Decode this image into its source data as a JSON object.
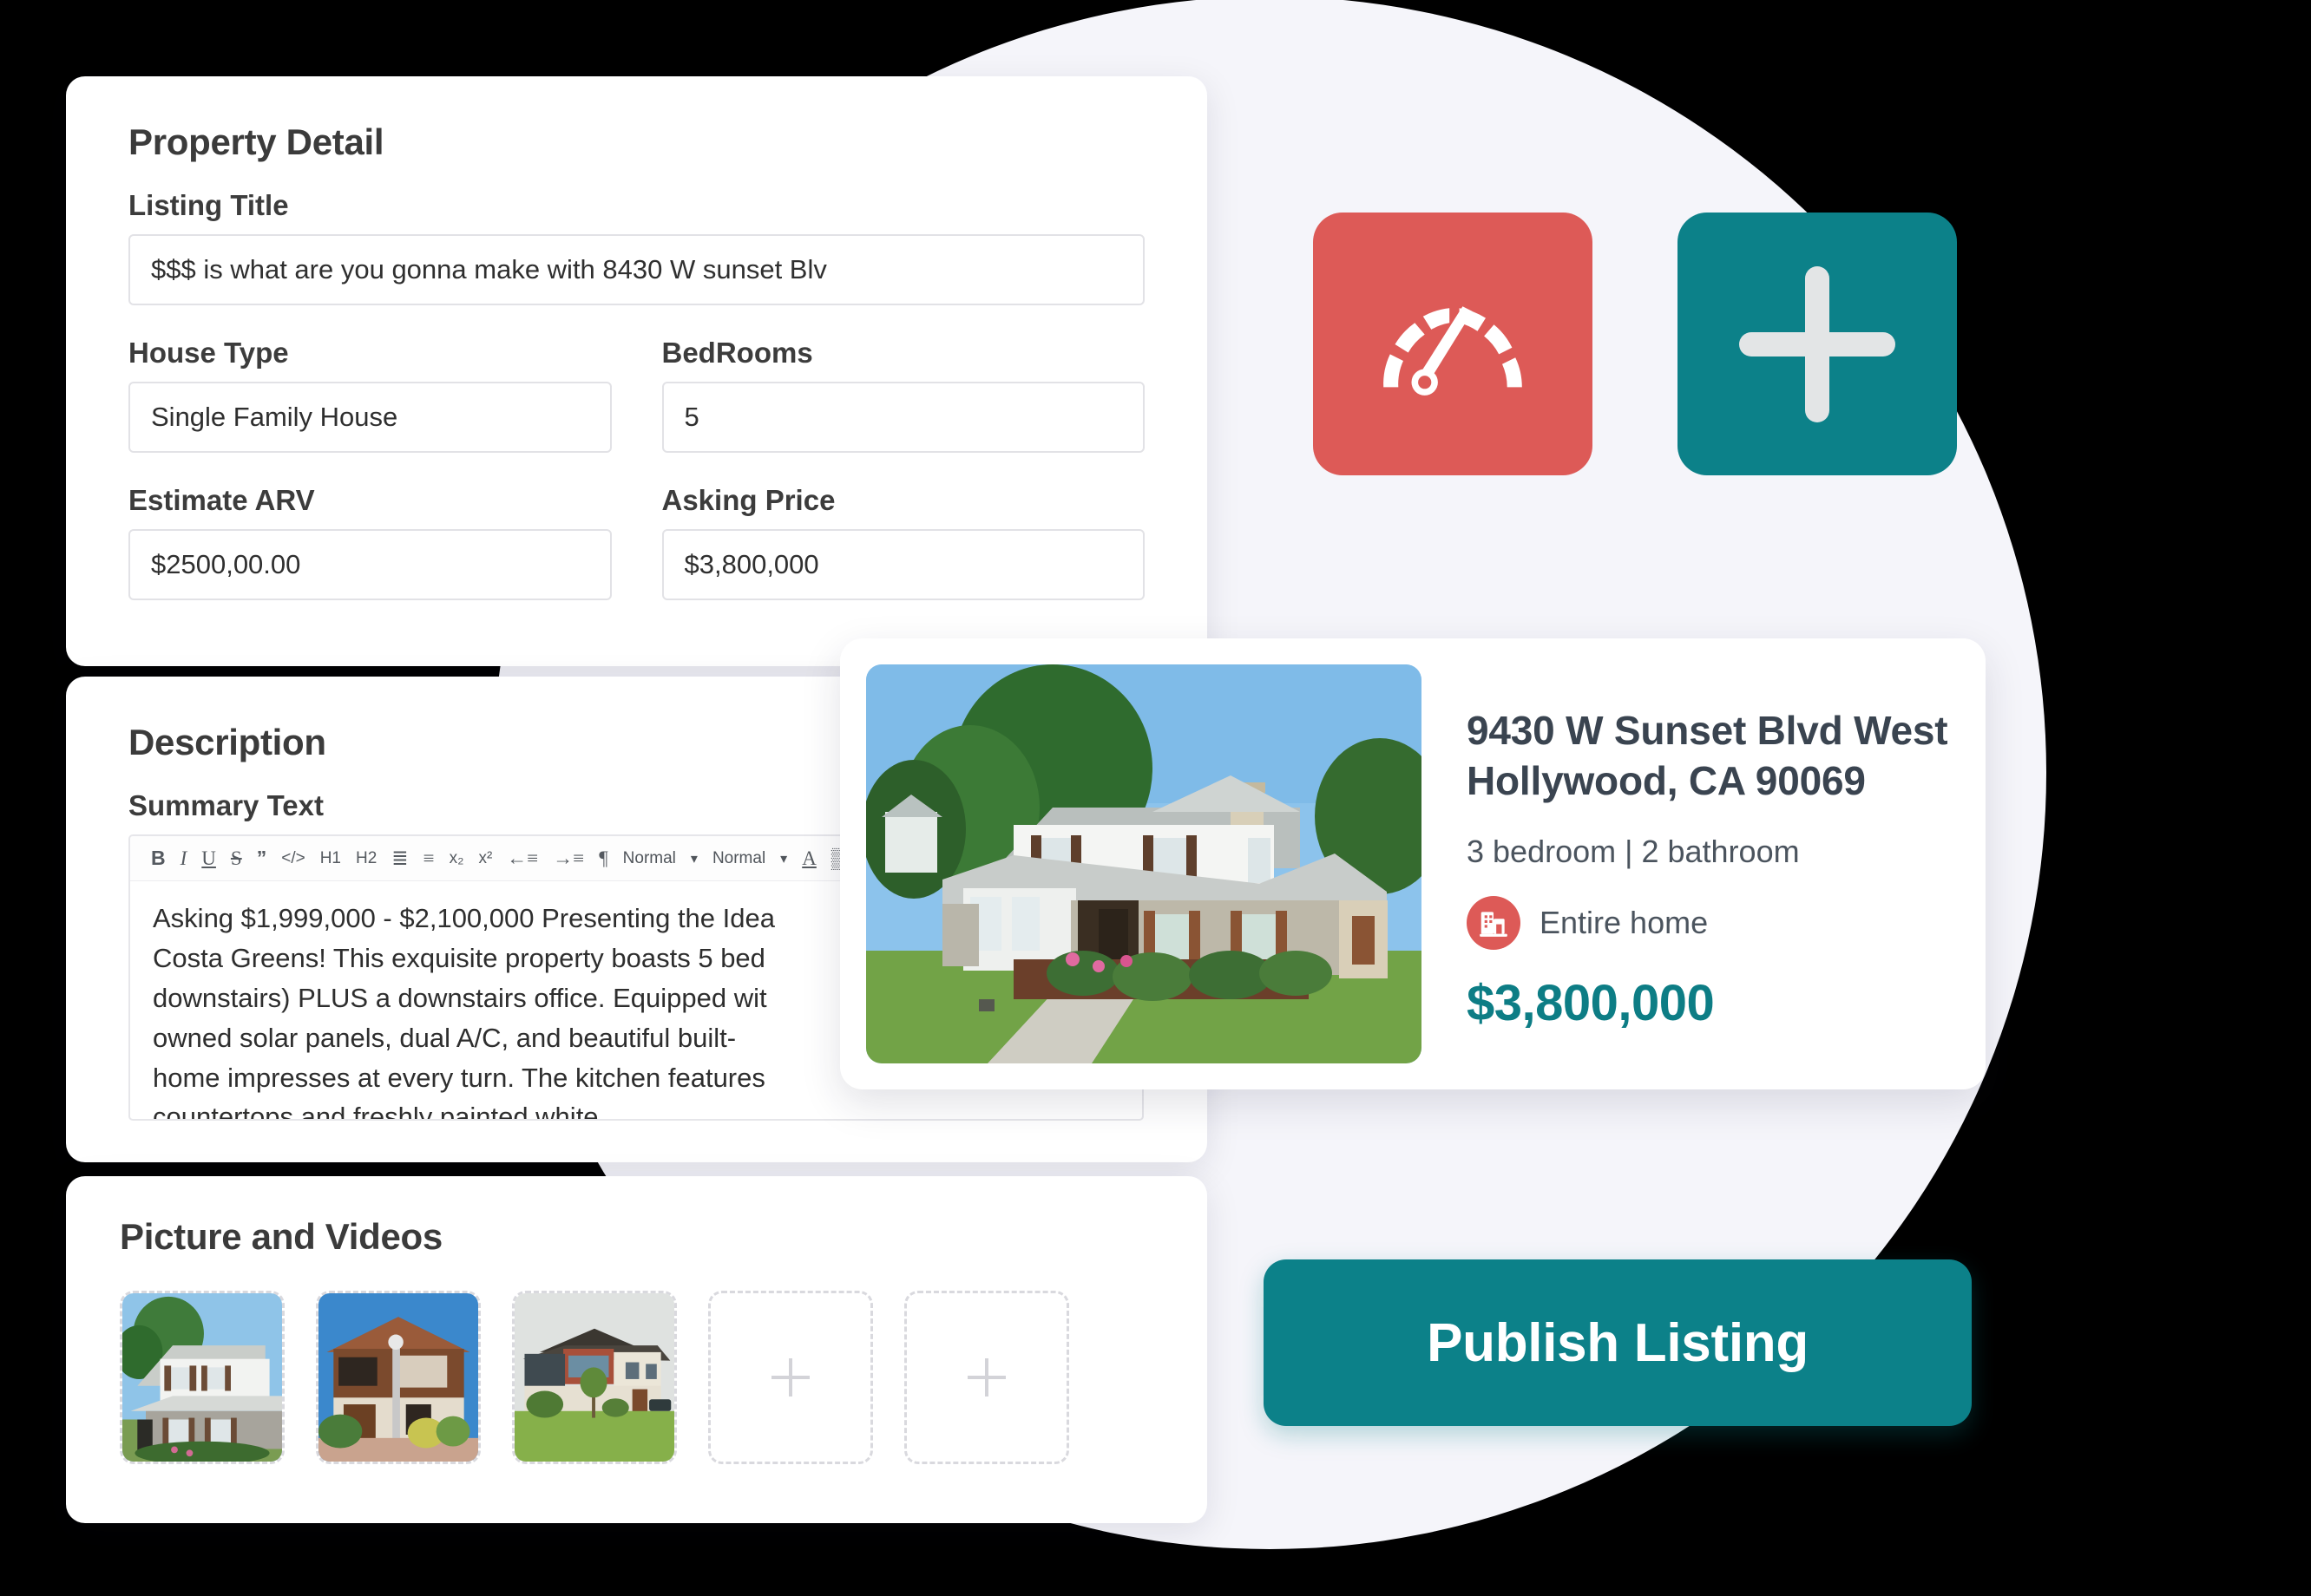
{
  "property_detail": {
    "title": "Property Detail",
    "listing_title": {
      "label": "Listing Title",
      "value": "$$$ is what are you gonna make with 8430 W sunset Blv",
      "placeholder": "Listing Title"
    },
    "house_type": {
      "label": "House Type",
      "value": "Single Family House",
      "placeholder": "House Type"
    },
    "bedrooms": {
      "label": "BedRooms",
      "value": "5",
      "placeholder": "BedRooms"
    },
    "estimate_arv": {
      "label": "Estimate ARV",
      "value": "$2500,00.00",
      "placeholder": "Estimate ARV"
    },
    "asking_price": {
      "label": "Asking Price",
      "value": "$3,800,000",
      "placeholder": "Asking Price"
    }
  },
  "description": {
    "title": "Description",
    "summary_label": "Summary Text",
    "toolbar": {
      "bold": "B",
      "italic": "I",
      "underline": "U",
      "strikethrough": "S",
      "blockquote": "”",
      "code": "</>",
      "h1": "H1",
      "h2": "H2",
      "ordered_list": "≣",
      "bullet_list": "≡",
      "subscript": "x₂",
      "superscript": "x²",
      "outdent": "←≡",
      "indent": "→≡",
      "direction": "¶",
      "font_size_value": "Normal",
      "block_style_value": "Normal",
      "text_color": "A",
      "highlight": "▒"
    },
    "summary_text": "Asking $1,999,000 - $2,100,000 Presenting the Idea\nCosta Greens! This exquisite property boasts 5 bed\ndownstairs) PLUS a downstairs office. Equipped wit\nowned solar panels, dual A/C, and beautiful built-\nhome impresses at every turn. The kitchen features\ncountertops and freshly painted white"
  },
  "media": {
    "title": "Picture and Videos",
    "thumbnails": [
      {
        "name": "white-siding-stone-house"
      },
      {
        "name": "brown-wood-modern-house"
      },
      {
        "name": "brick-cream-house-lawn"
      }
    ],
    "empty_slots": 2,
    "add_icon": "plus-icon"
  },
  "actions": {
    "gauge_button_icon": "gauge-icon",
    "add_button_icon": "plus-icon",
    "publish_label": "Publish Listing"
  },
  "preview": {
    "address": "9430 W Sunset Blvd West Hollywood, CA 90069",
    "address_line1": "9430 W Sunset Blvd West",
    "address_line2": "Hollywood, CA 90069",
    "beds_baths": "3 bedroom | 2 bathroom",
    "home_type": "Entire home",
    "home_type_icon": "building-icon",
    "price": "$3,800,000",
    "photo": "two-story-white-stone-house"
  },
  "colors": {
    "teal": "#0c8189",
    "teal_text": "#0d7d85",
    "red": "#dd5a57",
    "backdrop": "#f5f5fa",
    "card": "#ffffff",
    "heading": "#3b3b3b",
    "address": "#3a4450"
  }
}
